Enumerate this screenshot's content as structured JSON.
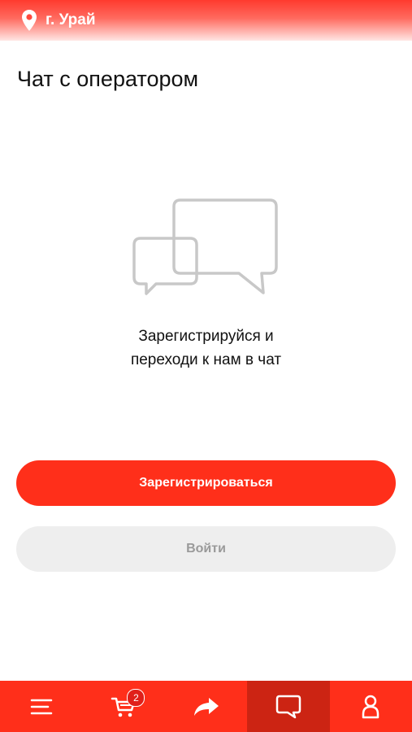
{
  "header": {
    "city": "г. Урай",
    "location_icon": "map-pin-icon"
  },
  "page": {
    "title": "Чат с оператором"
  },
  "empty_state": {
    "icon": "chat-bubbles-icon",
    "line1": "Зарегистрируйся и",
    "line2": "переходи к нам в чат"
  },
  "actions": {
    "register_label": "Зарегистрироваться",
    "login_label": "Войти"
  },
  "bottom_nav": {
    "items": [
      {
        "icon": "menu-icon",
        "active": false
      },
      {
        "icon": "cart-icon",
        "badge": "2",
        "active": false
      },
      {
        "icon": "share-icon",
        "active": false
      },
      {
        "icon": "chat-icon",
        "active": true
      },
      {
        "icon": "profile-icon",
        "active": false
      }
    ]
  },
  "colors": {
    "accent": "#ff2f1a",
    "active_tab": "#cc2413",
    "secondary_button": "#eeeeee",
    "secondary_text": "#9a9a9a"
  }
}
